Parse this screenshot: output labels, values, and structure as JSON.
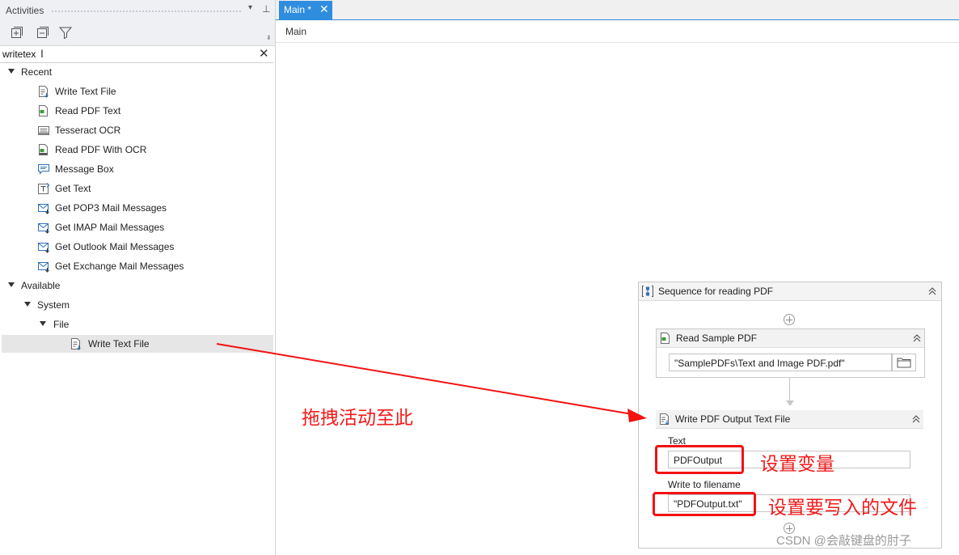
{
  "activities_panel": {
    "title": "Activities",
    "search": {
      "value": "writetex"
    },
    "tree": {
      "recent": {
        "label": "Recent",
        "items": [
          {
            "label": "Write Text File",
            "icon": "write-text-file-icon"
          },
          {
            "label": "Read PDF Text",
            "icon": "read-pdf-icon"
          },
          {
            "label": "Tesseract OCR",
            "icon": "ocr-icon"
          },
          {
            "label": "Read PDF With OCR",
            "icon": "read-pdf-ocr-icon"
          },
          {
            "label": "Message Box",
            "icon": "message-box-icon"
          },
          {
            "label": "Get Text",
            "icon": "get-text-icon"
          },
          {
            "label": "Get POP3 Mail Messages",
            "icon": "mail-icon"
          },
          {
            "label": "Get IMAP Mail Messages",
            "icon": "mail-icon"
          },
          {
            "label": "Get Outlook Mail Messages",
            "icon": "mail-icon"
          },
          {
            "label": "Get Exchange Mail Messages",
            "icon": "mail-icon"
          }
        ]
      },
      "available": {
        "label": "Available",
        "system": {
          "label": "System",
          "file": {
            "label": "File",
            "items": [
              {
                "label": "Write Text File",
                "icon": "write-text-file-icon"
              }
            ]
          }
        }
      }
    }
  },
  "tabs": [
    {
      "label": "Main *",
      "active": true
    }
  ],
  "breadcrumb": "Main",
  "designer": {
    "sequence": {
      "title": "Sequence for reading PDF",
      "activities": [
        {
          "title": "Read Sample PDF",
          "file_value": "\"SamplePDFs\\Text and Image PDF.pdf\""
        },
        {
          "title": "Write PDF Output Text File",
          "text_label": "Text",
          "text_value": "PDFOutput",
          "filename_label": "Write to filename",
          "filename_value": "\"PDFOutput.txt\""
        }
      ]
    }
  },
  "annotations": {
    "drag_note": "拖拽活动至此",
    "set_variable": "设置变量",
    "set_file": "设置要写入的文件"
  },
  "watermark": "CSDN @会敲键盘的肘子",
  "colors": {
    "accent": "#2f8ddf",
    "annotation_red": "#f21212"
  }
}
